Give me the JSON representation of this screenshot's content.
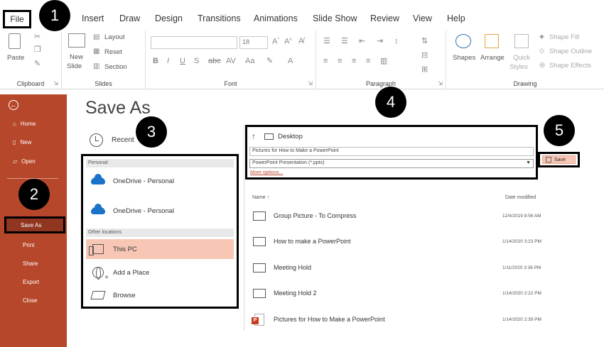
{
  "ribbon": {
    "tabs": [
      "File",
      "Insert",
      "Draw",
      "Design",
      "Transitions",
      "Animations",
      "Slide Show",
      "Review",
      "View",
      "Help"
    ],
    "clipboard": {
      "paste": "Paste",
      "label": "Clipboard"
    },
    "slides": {
      "new_slide_1": "New",
      "new_slide_2": "Slide",
      "layout": "Layout",
      "reset": "Reset",
      "section": "Section",
      "label": "Slides"
    },
    "font": {
      "size": "18",
      "label": "Font"
    },
    "paragraph": {
      "label": "Paragraph"
    },
    "drawing": {
      "shapes": "Shapes",
      "arrange": "Arrange",
      "quick_styles_1": "Quick",
      "quick_styles_2": "Styles",
      "shape_fill": "Shape Fill",
      "shape_outline": "Shape Outline",
      "shape_effects": "Shape Effects",
      "label": "Drawing"
    }
  },
  "nav": {
    "items": [
      "Home",
      "New",
      "Open",
      "Save As",
      "Print",
      "Share",
      "Export",
      "Close"
    ]
  },
  "page_title": "Save As",
  "recent_label": "Recent",
  "locations": {
    "personal_header": "Personal",
    "onedrive_1": "OneDrive - Personal",
    "onedrive_2": "OneDrive - Personal",
    "other_header": "Other locations",
    "this_pc": "This PC",
    "add_place": "Add a Place",
    "browse": "Browse"
  },
  "save_panel": {
    "folder": "Desktop",
    "filename": "Pictures for How to Make a PowerPoint",
    "filetype": "PowerPoint Presentation (*.pptx)",
    "more_options": "More options...",
    "save_button": "Save"
  },
  "file_list": {
    "col_name": "Name",
    "col_date": "Date modified",
    "rows": [
      {
        "name": "Group Picture - To Compress",
        "date": "12/4/2019 8:56 AM",
        "type": "folder"
      },
      {
        "name": "How to make a PowerPoint",
        "date": "1/14/2020 3:23 PM",
        "type": "folder"
      },
      {
        "name": "Meeting Hold",
        "date": "1/11/2020 3:36 PM",
        "type": "folder"
      },
      {
        "name": "Meeting Hold 2",
        "date": "1/14/2020 2:22 PM",
        "type": "folder"
      },
      {
        "name": "Pictures for How to Make a PowerPoint",
        "date": "1/14/2020 2:39 PM",
        "type": "pptx"
      }
    ]
  },
  "markers": [
    "1",
    "2",
    "3",
    "4",
    "5"
  ],
  "colors": {
    "accent": "#b7472a",
    "selected": "#f8c6b4",
    "nav_selected": "#8f3520"
  }
}
